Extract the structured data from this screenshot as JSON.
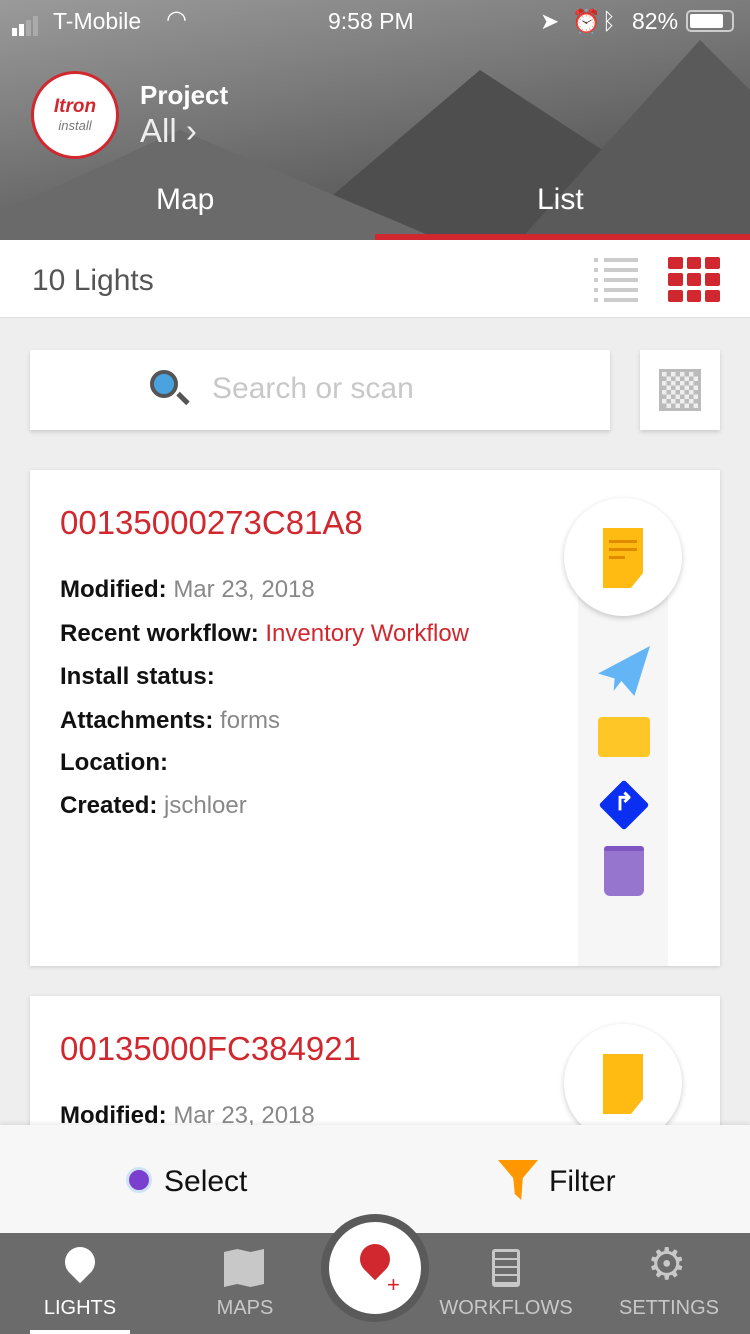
{
  "status_bar": {
    "carrier": "T-Mobile",
    "time": "9:58 PM",
    "battery": "82%",
    "battery_level": 0.82
  },
  "header": {
    "logo_text": "Itron",
    "logo_sub": "install",
    "project_label": "Project",
    "project_value": "All",
    "project_chevron": "›",
    "tabs": [
      {
        "label": "Map",
        "active": false
      },
      {
        "label": "List",
        "active": true
      }
    ],
    "accent": "#d0282e"
  },
  "subheader": {
    "count_label": "10 Lights",
    "view_modes": [
      "list-view-icon",
      "grid-view-icon"
    ],
    "active_view": "grid"
  },
  "search": {
    "placeholder": "Search or scan"
  },
  "cards": [
    {
      "id": "00135000273C81A8",
      "fields": [
        {
          "label": "Modified:",
          "value": "Mar 23, 2018",
          "style": "gray"
        },
        {
          "label": "Recent workflow:",
          "value": "Inventory Workflow",
          "style": "red"
        },
        {
          "label": "Install status:",
          "value": ""
        },
        {
          "label": "Attachments:",
          "value": "forms",
          "style": "gray"
        },
        {
          "label": "Location:",
          "value": ""
        },
        {
          "label": "Created:",
          "value": "jschloer",
          "style": "gray"
        }
      ],
      "actions": [
        "note-icon",
        "send-icon",
        "folder-icon",
        "directions-icon",
        "trash-icon"
      ]
    },
    {
      "id": "00135000FC384921",
      "fields": [
        {
          "label": "Modified:",
          "value": "Mar 23, 2018",
          "style": "gray"
        }
      ]
    }
  ],
  "action_bar": {
    "select": "Select",
    "filter": "Filter"
  },
  "tab_bar": {
    "items": [
      {
        "label": "LIGHTS",
        "active": true
      },
      {
        "label": "MAPS"
      },
      {
        "label": "WORKFLOWS"
      },
      {
        "label": "SETTINGS"
      }
    ],
    "center": "add-light-button"
  }
}
